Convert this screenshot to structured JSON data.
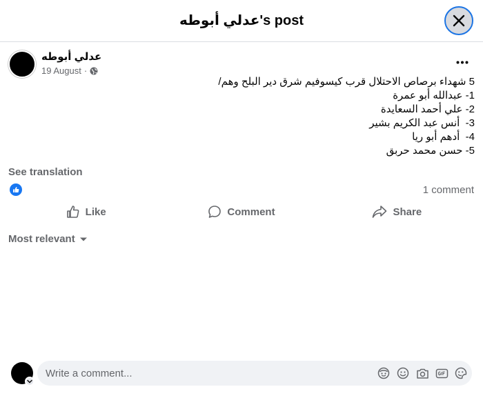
{
  "header": {
    "title": "عدلي أبوطه's post"
  },
  "post": {
    "author": "عدلي أبوطه",
    "date": "19 August",
    "separator": "·",
    "privacy_icon": "globe-icon",
    "lines": [
      "5 شهداء برصاص الاحتلال قرب كيسوفيم شرق دير البلح وهم/",
      "1- عبدالله أبو عمرة",
      "2- علي أحمد السعايدة",
      "3-  أنس عبد الكريم بشير",
      "4-  أدهم أبو ريا",
      "5- حسن محمد حربق"
    ],
    "see_translation": "See translation"
  },
  "reactions": {
    "reaction_icon": "like-icon",
    "comment_count": "1 comment"
  },
  "actions": {
    "like": "Like",
    "comment": "Comment",
    "share": "Share"
  },
  "comments": {
    "sort_label": "Most relevant"
  },
  "composer": {
    "placeholder": "Write a comment..."
  },
  "colors": {
    "accent": "#1877f2",
    "secondary_text": "#65676b",
    "input_bg": "#f0f2f5"
  }
}
